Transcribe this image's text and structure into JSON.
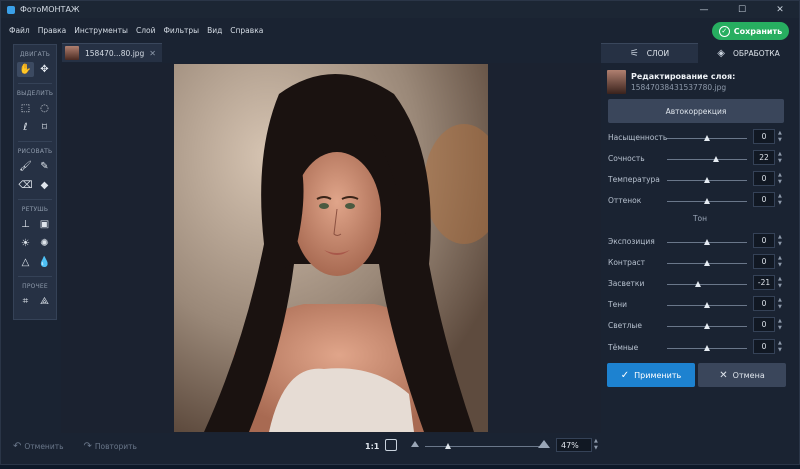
{
  "window": {
    "title": "ФотоМОНТАЖ",
    "minimize": "—",
    "maximize": "☐",
    "close": "✕"
  },
  "menu": [
    "Файл",
    "Правка",
    "Инструменты",
    "Слой",
    "Фильтры",
    "Вид",
    "Справка"
  ],
  "save_label": "Сохранить",
  "toolbar": {
    "groups": [
      {
        "label": "ДВИГАТЬ"
      },
      {
        "label": "ВЫДЕЛИТЬ"
      },
      {
        "label": "РИСОВАТЬ"
      },
      {
        "label": "РЕТУШЬ"
      },
      {
        "label": "ПРОЧЕЕ"
      }
    ]
  },
  "document_tab": {
    "name": "158470...80.jpg",
    "close": "✕"
  },
  "panel": {
    "tabs": [
      {
        "label": "СЛОИ"
      },
      {
        "label": "ОБРАБОТКА"
      }
    ],
    "layer_title": "Редактирование слоя:",
    "layer_file": "15847038431537780.jpg",
    "autocorrect": "Автокоррекция",
    "section_tone": "Тон",
    "sliders": [
      {
        "label": "Насыщенность",
        "value": "0",
        "level": 0.5
      },
      {
        "label": "Сочность",
        "value": "22",
        "level": 0.61
      },
      {
        "label": "Температура",
        "value": "0",
        "level": 0.5
      },
      {
        "label": "Оттенок",
        "value": "0",
        "level": 0.5
      },
      {
        "label": "Экспозиция",
        "value": "0",
        "level": 0.5
      },
      {
        "label": "Контраст",
        "value": "0",
        "level": 0.5
      },
      {
        "label": "Засветки",
        "value": "-21",
        "level": 0.39
      },
      {
        "label": "Тени",
        "value": "0",
        "level": 0.5
      },
      {
        "label": "Светлые",
        "value": "0",
        "level": 0.5
      },
      {
        "label": "Тёмные",
        "value": "0",
        "level": 0.5
      }
    ],
    "apply": "Применить",
    "cancel": "Отмена"
  },
  "bottom": {
    "undo": "Отменить",
    "redo": "Повторить",
    "ratio": "1:1",
    "zoom": "47%",
    "zoom_level": 0.2
  }
}
